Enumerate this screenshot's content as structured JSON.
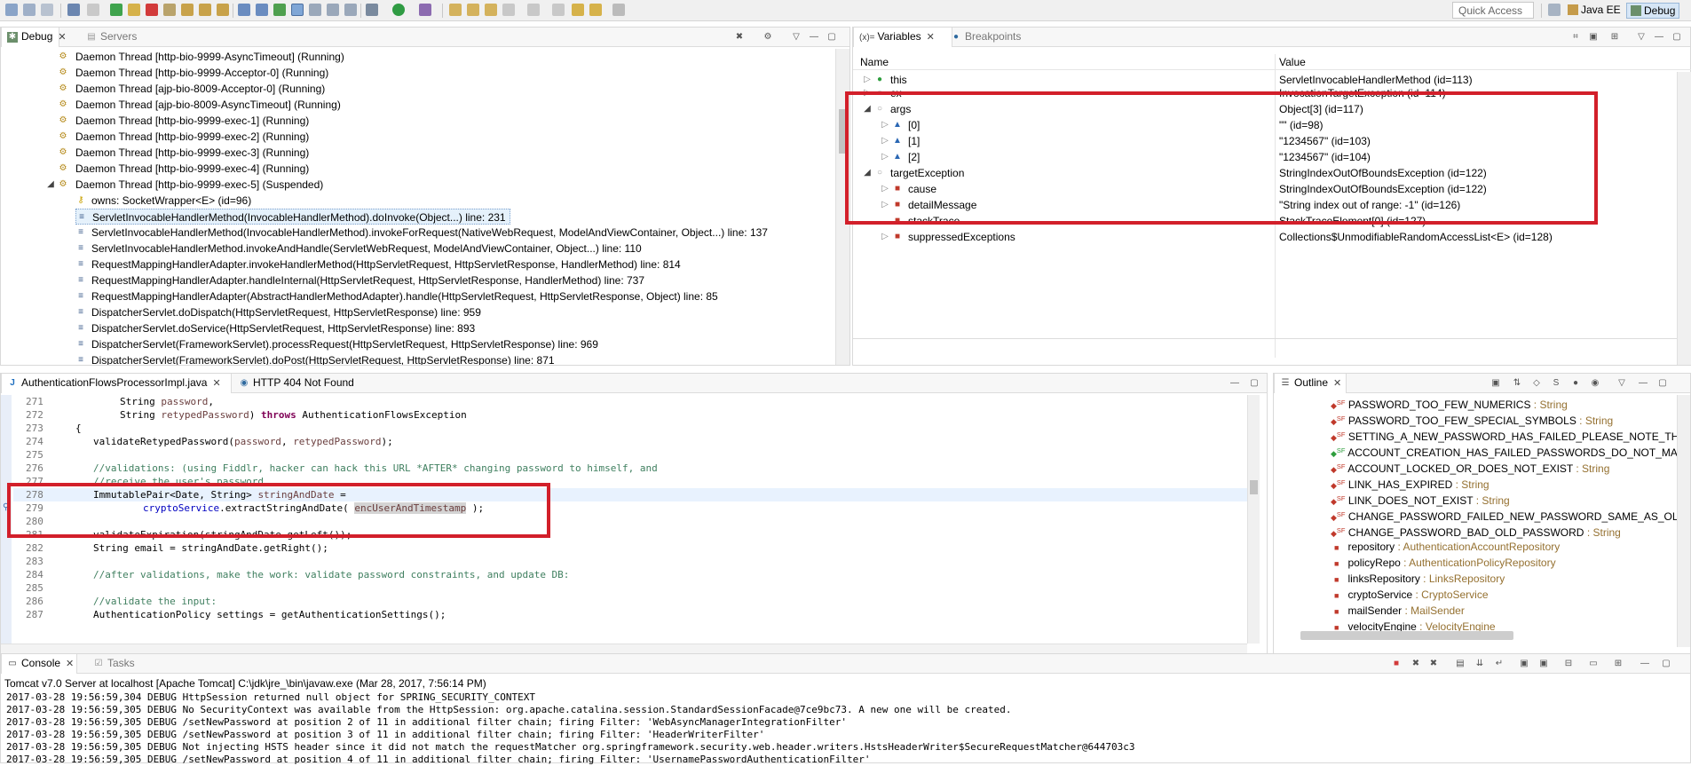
{
  "toolbar": {
    "quick_access": "Quick Access",
    "perspectives": [
      "Java EE",
      "Debug"
    ]
  },
  "debug_panel": {
    "tabs": [
      {
        "label": "Debug"
      },
      {
        "label": "Servers"
      }
    ],
    "items": [
      "Daemon Thread [http-bio-9999-AsyncTimeout] (Running)",
      "Daemon Thread [http-bio-9999-Acceptor-0] (Running)",
      "Daemon Thread [ajp-bio-8009-Acceptor-0] (Running)",
      "Daemon Thread [ajp-bio-8009-AsyncTimeout] (Running)",
      "Daemon Thread [http-bio-9999-exec-1] (Running)",
      "Daemon Thread [http-bio-9999-exec-2] (Running)",
      "Daemon Thread [http-bio-9999-exec-3] (Running)",
      "Daemon Thread [http-bio-9999-exec-4] (Running)",
      "Daemon Thread [http-bio-9999-exec-5] (Suspended)",
      "owns: SocketWrapper<E>  (id=96)",
      "ServletInvocableHandlerMethod(InvocableHandlerMethod).doInvoke(Object...) line: 231",
      "ServletInvocableHandlerMethod(InvocableHandlerMethod).invokeForRequest(NativeWebRequest, ModelAndViewContainer, Object...) line: 137",
      "ServletInvocableHandlerMethod.invokeAndHandle(ServletWebRequest, ModelAndViewContainer, Object...) line: 110",
      "RequestMappingHandlerAdapter.invokeHandlerMethod(HttpServletRequest, HttpServletResponse, HandlerMethod) line: 814",
      "RequestMappingHandlerAdapter.handleInternal(HttpServletRequest, HttpServletResponse, HandlerMethod) line: 737",
      "RequestMappingHandlerAdapter(AbstractHandlerMethodAdapter).handle(HttpServletRequest, HttpServletResponse, Object) line: 85",
      "DispatcherServlet.doDispatch(HttpServletRequest, HttpServletResponse) line: 959",
      "DispatcherServlet.doService(HttpServletRequest, HttpServletResponse) line: 893",
      "DispatcherServlet(FrameworkServlet).processRequest(HttpServletRequest, HttpServletResponse) line: 969",
      "DispatcherServlet(FrameworkServlet).doPost(HttpServletRequest, HttpServletResponse) line: 871"
    ]
  },
  "variables_panel": {
    "tabs": [
      {
        "label": "Variables"
      },
      {
        "label": "Breakpoints"
      }
    ],
    "tab_prefix": "(x)=",
    "columns": [
      "Name",
      "Value"
    ],
    "rows": [
      {
        "name": "this",
        "value": "ServletInvocableHandlerMethod  (id=113)"
      },
      {
        "name": "ex",
        "value": "InvocationTargetException  (id=114)"
      },
      {
        "name": "args",
        "value": "Object[3]  (id=117)"
      },
      {
        "name": "[0]",
        "value": "\"\" (id=98)"
      },
      {
        "name": "[1]",
        "value": "\"1234567\" (id=103)"
      },
      {
        "name": "[2]",
        "value": "\"1234567\" (id=104)"
      },
      {
        "name": "targetException",
        "value": "StringIndexOutOfBoundsException  (id=122)"
      },
      {
        "name": "cause",
        "value": "StringIndexOutOfBoundsException  (id=122)"
      },
      {
        "name": "detailMessage",
        "value": "\"String index out of range: -1\" (id=126)"
      },
      {
        "name": "stackTrace",
        "value": "StackTraceElement[0]  (id=127)"
      },
      {
        "name": "suppressedExceptions",
        "value": "Collections$UnmodifiableRandomAccessList<E>  (id=128)"
      }
    ]
  },
  "editor": {
    "tabs": [
      {
        "label": "AuthenticationFlowsProcessorImpl.java"
      },
      {
        "label": "HTTP 404 Not Found"
      }
    ],
    "line_numbers": [
      "271",
      "272",
      "273",
      "274",
      "275",
      "276",
      "277",
      "278",
      "279",
      "280",
      "281",
      "282",
      "283",
      "284",
      "285",
      "286",
      "287"
    ],
    "lines": {
      "l271a": "String ",
      "l271b": "password",
      "l271c": ",",
      "l272a": "String ",
      "l272b": "retypedPassword",
      "l272c": ") ",
      "l272d": "throws",
      "l272e": " AuthenticationFlowsException",
      "l273": "{",
      "l274a": "validateRetypedPassword(",
      "l274b": "password",
      "l274c": ", ",
      "l274d": "retypedPassword",
      "l274e": ");",
      "l276": "//validations: (using Fiddlr, hacker can hack this URL *AFTER* changing password to himself, and",
      "l277": "//receive the user's password",
      "l278a": "ImmutablePair<Date, String> ",
      "l278b": "stringAndDate",
      "l278c": " =",
      "l279a": "cryptoService",
      "l279b": ".extractStringAndDate( ",
      "l279c": "encUserAndTimestamp",
      "l279d": " );",
      "l281": "validateExpiration(stringAndDate.getLeft());",
      "l282": "String email = stringAndDate.getRight();",
      "l284": "//after validations, make the work: validate password constraints, and update DB:",
      "l286": "//validate the input:",
      "l287": "AuthenticationPolicy settings = getAuthenticationSettings();"
    }
  },
  "outline": {
    "tab": "Outline",
    "items": [
      {
        "name": "PASSWORD_TOO_FEW_NUMERICS",
        "type": " : String"
      },
      {
        "name": "PASSWORD_TOO_FEW_SPECIAL_SYMBOLS",
        "type": " : String"
      },
      {
        "name": "SETTING_A_NEW_PASSWORD_HAS_FAILED_PLEASE_NOTE_THE_PASSW",
        "type": ""
      },
      {
        "name": "ACCOUNT_CREATION_HAS_FAILED_PASSWORDS_DO_NOT_MATCH",
        "type": " : S"
      },
      {
        "name": "ACCOUNT_LOCKED_OR_DOES_NOT_EXIST",
        "type": " : String"
      },
      {
        "name": "LINK_HAS_EXPIRED",
        "type": " : String"
      },
      {
        "name": "LINK_DOES_NOT_EXIST",
        "type": " : String"
      },
      {
        "name": "CHANGE_PASSWORD_FAILED_NEW_PASSWORD_SAME_AS_OLD_PASSW",
        "type": ""
      },
      {
        "name": "CHANGE_PASSWORD_BAD_OLD_PASSWORD",
        "type": " : String"
      },
      {
        "name": "repository",
        "type": " : AuthenticationAccountRepository"
      },
      {
        "name": "policyRepo",
        "type": " : AuthenticationPolicyRepository"
      },
      {
        "name": "linksRepository",
        "type": " : LinksRepository"
      },
      {
        "name": "cryptoService",
        "type": " : CryptoService"
      },
      {
        "name": "mailSender",
        "type": " : MailSender"
      },
      {
        "name": "velocityEngine",
        "type": " : VelocityEngine"
      }
    ]
  },
  "console": {
    "tabs": [
      {
        "label": "Console"
      },
      {
        "label": "Tasks"
      }
    ],
    "header": "Tomcat v7.0 Server at localhost [Apache Tomcat] C:\\jdk\\jre_\\bin\\javaw.exe (Mar 28, 2017, 7:56:14 PM)",
    "lines": [
      "2017-03-28 19:56:59,304 DEBUG HttpSession returned null object for SPRING_SECURITY_CONTEXT",
      "2017-03-28 19:56:59,305 DEBUG No SecurityContext was available from the HttpSession: org.apache.catalina.session.StandardSessionFacade@7ce9bc73. A new one will be created.",
      "2017-03-28 19:56:59,305 DEBUG /setNewPassword at position 2 of 11 in additional filter chain; firing Filter: 'WebAsyncManagerIntegrationFilter'",
      "2017-03-28 19:56:59,305 DEBUG /setNewPassword at position 3 of 11 in additional filter chain; firing Filter: 'HeaderWriterFilter'",
      "2017-03-28 19:56:59,305 DEBUG Not injecting HSTS header since it did not match the requestMatcher org.springframework.security.web.header.writers.HstsHeaderWriter$SecureRequestMatcher@644703c3",
      "2017-03-28 19:56:59,305 DEBUG /setNewPassword at position 4 of 11 in additional filter chain; firing Filter: 'UsernamePasswordAuthenticationFilter'"
    ]
  },
  "colors": {
    "highlight_box": "#d21f2a",
    "selection": "#e5f1fb",
    "keyword": "#7f0055",
    "comment": "#3f7f5f"
  }
}
